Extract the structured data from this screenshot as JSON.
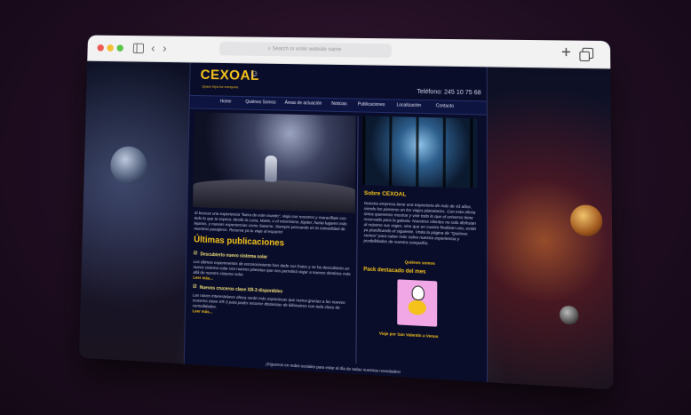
{
  "browser": {
    "address_placeholder": "Search or enter website name",
    "back": "‹",
    "forward": "›",
    "new_tab": "+"
  },
  "site": {
    "logo": "CEXOAL",
    "tagline": "Space trips for everyone",
    "phone": "Teléfono: 245 10 75 68",
    "menu": [
      "Home",
      "Quiénes Somos",
      "Áreas de actuación",
      "Noticias",
      "Publicaciones",
      "Localización",
      "Contacto"
    ]
  },
  "left": {
    "intro": "Si buscas una experiencia \"fuera de este mundo\", viaja con nosotros y maravíllate con todo lo que te espera: desde la Luna, Marte, o el mismísimo Júpiter, hasta lugares más lejanos, y nuevas experiencias como Saturno. Siempre pensando en la comodidad de nuestros pasajeros. Reserva ya tu viaje al espacio!",
    "pub_title": "Últimas publicaciones",
    "post1_title": "Descubierto nuevo sistema solar",
    "post1_text": "Los últimos experimentos de reconocimiento han dado sus frutos y se ha descubierto un nuevo sistema solar con nuevos planetas que nos permitirá viajar a nuevos destinos más allá de nuestro sistema solar.",
    "post1_more": "Leer más...",
    "post2_title": "Nuevos cruceros clase XR-3 disponibles",
    "post2_text": "Las naves interestelares ahora serán más espaciosas que nunca gracias a los nuevos cruceros clase XR-3 para poder recorrer distancias de kilómetros con toda clase de comodidades.",
    "post2_more": "Leer más..."
  },
  "right": {
    "about_title": "Sobre CEXOAL",
    "about_text": "Nuestra empresa tiene una trayectoria de más de 43 años, siendo los pioneros en los viajes planetarios. Con esta oferta única queremos mostrar y vivir todo lo que el universo tiene reservado para la galaxia. Nuestros clientes no solo disfrutan al máximo sus viajes, sino que en cuanto finalizan uno, están ya planificando el siguiente. Visita la página de \"Quiénes somos\" para saber más sobre nuestra experiencia y posibilidades de nuestra compañía.",
    "about_link": "Quiénes somos",
    "pack_title": "Pack destacado del mes",
    "pack_caption": "Viaje por San Valentín a Venus"
  },
  "footer": "¡Síguenos en redes sociales para estar al día de todas nuestras novedades!",
  "colors": {
    "accent": "#f4c21b",
    "page_bg": "#0a0d2a"
  }
}
